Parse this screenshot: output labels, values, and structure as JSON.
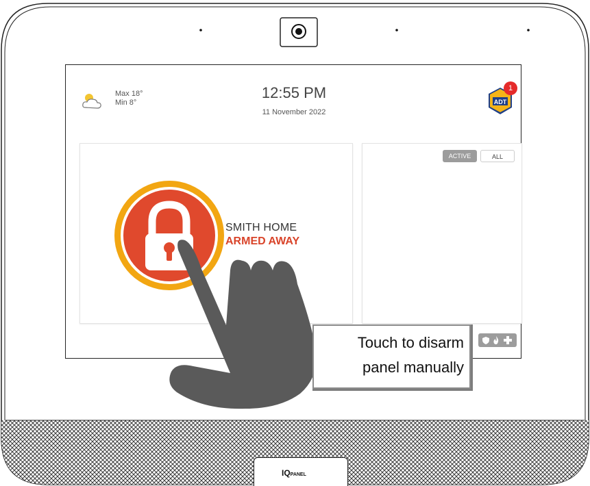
{
  "weather": {
    "icon": "partly-cloudy-icon",
    "max": "Max 18°",
    "min": "Min 8°"
  },
  "clock": {
    "time": "12:55 PM",
    "date": "11 November 2022"
  },
  "badge": {
    "logo": "ADT",
    "count": "1"
  },
  "status": {
    "name": "SMITH HOME",
    "state": "ARMED AWAY",
    "state_color": "#d9442a",
    "ring_color": "#f2a612"
  },
  "tabs": {
    "active": "ACTIVE",
    "all": "ALL"
  },
  "callout": {
    "line1": "Touch to disarm",
    "line2": "panel manually"
  },
  "branding": {
    "logo_main": "IQ",
    "logo_sub": "PANEL"
  }
}
